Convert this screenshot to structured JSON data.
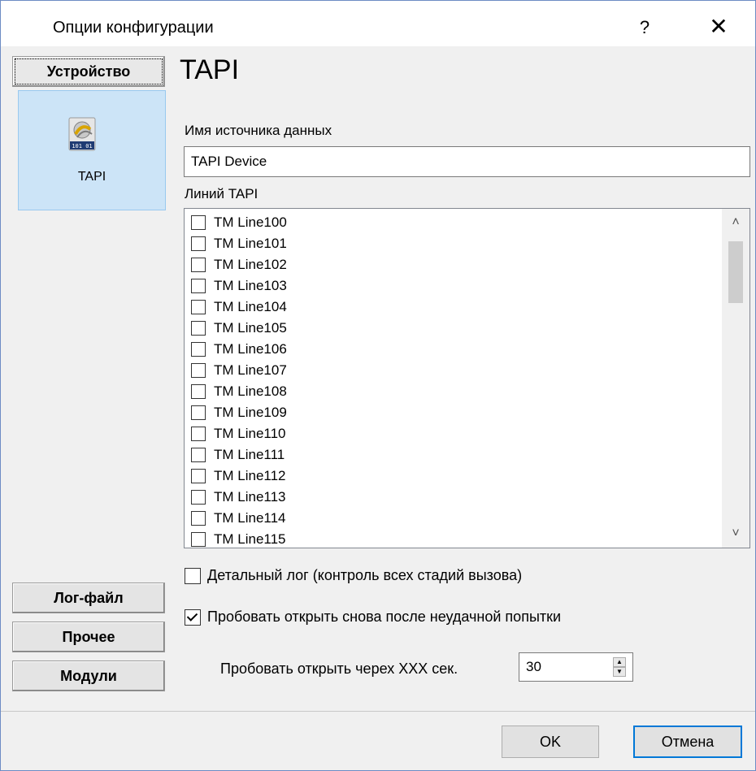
{
  "window": {
    "title": "Опции конфигурации",
    "help_label": "?",
    "close_label": "✕"
  },
  "sidebar": {
    "active_button": "Устройство",
    "module_label": "TAPI",
    "bottom_buttons": [
      "Лог-файл",
      "Прочее",
      "Модули"
    ]
  },
  "content": {
    "section_title": "TAPI",
    "datasource_label": "Имя источника данных",
    "datasource_value": "TAPI Device",
    "lines_label": "Линий TAPI",
    "lines": [
      {
        "label": "TM Line100",
        "checked": false
      },
      {
        "label": "TM Line101",
        "checked": false
      },
      {
        "label": "TM Line102",
        "checked": false
      },
      {
        "label": "TM Line103",
        "checked": false
      },
      {
        "label": "TM Line104",
        "checked": false
      },
      {
        "label": "TM Line105",
        "checked": false
      },
      {
        "label": "TM Line106",
        "checked": false
      },
      {
        "label": "TM Line107",
        "checked": false
      },
      {
        "label": "TM Line108",
        "checked": false
      },
      {
        "label": "TM Line109",
        "checked": false
      },
      {
        "label": "TM Line110",
        "checked": false
      },
      {
        "label": "TM Line111",
        "checked": false
      },
      {
        "label": "TM Line112",
        "checked": false
      },
      {
        "label": "TM Line113",
        "checked": false
      },
      {
        "label": "TM Line114",
        "checked": false
      },
      {
        "label": "TM Line115",
        "checked": false
      }
    ],
    "detailed_log": {
      "label": "Детальный лог (контроль всех стадий вызова)",
      "checked": false
    },
    "retry_open": {
      "label": "Пробовать открыть снова после неудачной попытки",
      "checked": true
    },
    "retry_interval_label": "Пробовать открыть черех XXX сек.",
    "retry_interval_value": "30"
  },
  "footer": {
    "ok_label": "OK",
    "cancel_label": "Отмена"
  }
}
